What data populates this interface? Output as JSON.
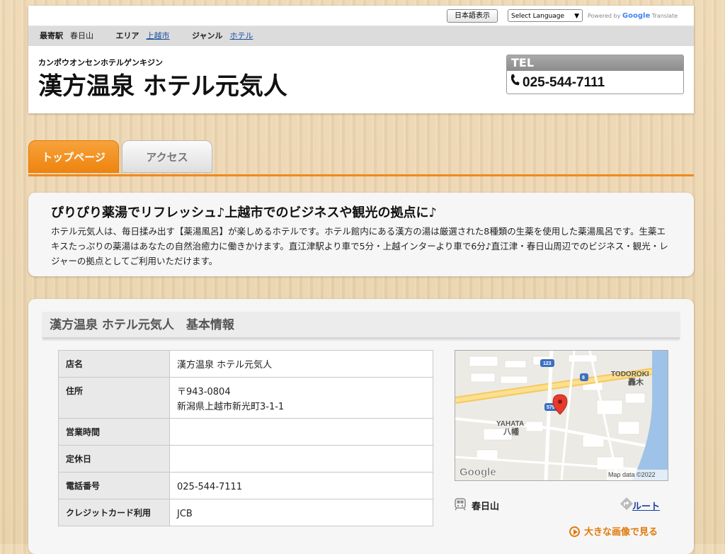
{
  "topbar": {
    "jp_button": "日本語表示",
    "lang_select": "Select Language",
    "powered_prefix": "Powered by",
    "powered_brand": "Google",
    "powered_suffix": "Translate"
  },
  "infobar": {
    "station_label": "最寄駅",
    "station_value": "春日山",
    "area_label": "エリア",
    "area_link": "上越市",
    "genre_label": "ジャンル",
    "genre_link": "ホテル"
  },
  "header": {
    "kana": "カンポウオンセンホテルゲンキジン",
    "name": "漢方温泉 ホテル元気人",
    "tel_label": "TEL",
    "tel_number": "025-544-7111"
  },
  "tabs": [
    {
      "label": "トップページ",
      "active": true
    },
    {
      "label": "アクセス",
      "active": false
    }
  ],
  "intro": {
    "heading": "ぴりぴり薬湯でリフレッシュ♪上越市でのビジネスや観光の拠点に♪",
    "body": "ホテル元気人は、毎日揉み出す【薬湯風呂】が楽しめるホテルです。ホテル館内にある漢方の湯は厳選された8種類の生薬を使用した薬湯風呂です。生薬エキスたっぷりの薬湯はあなたの自然治癒力に働きかけます。直江津駅より車で5分・上越インターより車で6分♪直江津・春日山周辺でのビジネス・観光・レジャーの拠点としてご利用いただけます。"
  },
  "info": {
    "title": "漢方温泉 ホテル元気人　基本情報",
    "rows": [
      {
        "key": "店名",
        "value": "漢方温泉 ホテル元気人",
        "value2": ""
      },
      {
        "key": "住所",
        "value": "〒943-0804",
        "value2": "新潟県上越市新光町3-1-1"
      },
      {
        "key": "営業時間",
        "value": "",
        "value2": ""
      },
      {
        "key": "定休日",
        "value": "",
        "value2": ""
      },
      {
        "key": "電話番号",
        "value": "025-544-7111",
        "value2": ""
      },
      {
        "key": "クレジットカード利用",
        "value": "JCB",
        "value2": ""
      }
    ]
  },
  "map": {
    "label_todoroki_en": "TODOROKI",
    "label_todoroki_jp": "轟木",
    "label_yahata_en": "YAHATA",
    "label_yahata_jp": "八幡",
    "route_123": "123",
    "route_8": "8",
    "route_579": "579",
    "google_logo": "Google",
    "map_data": "Map data ©2022"
  },
  "access": {
    "station": "春日山",
    "route_link": "ルート",
    "big_image_link": "大きな画像で見る"
  },
  "colors": {
    "accent_orange": "#f08a1c",
    "link_blue": "#1a4fa0"
  }
}
